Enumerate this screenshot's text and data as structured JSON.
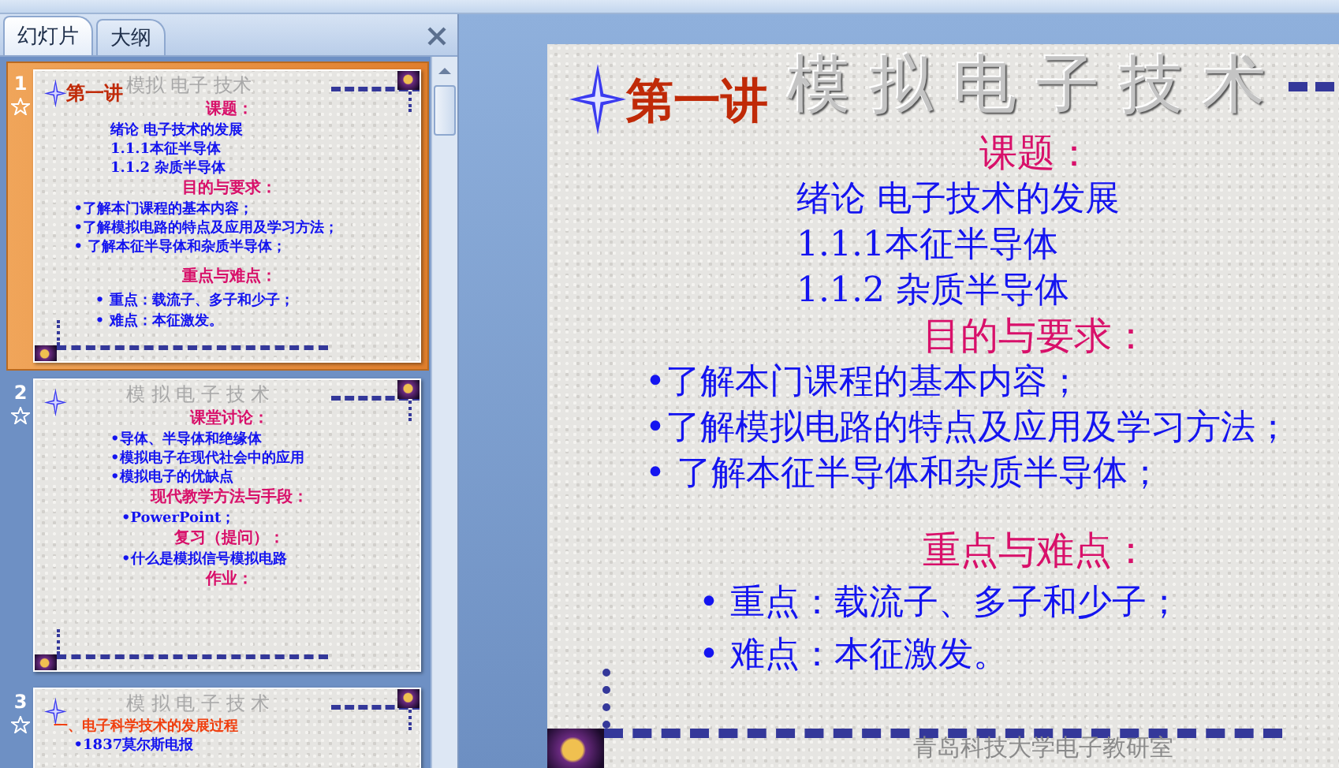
{
  "panel": {
    "tabs": [
      {
        "label": "幻灯片",
        "selected": true
      },
      {
        "label": "大纲",
        "selected": false
      }
    ]
  },
  "thumbnails": [
    {
      "number": "1",
      "selected": true,
      "title": "模拟 电子 技术",
      "label": "第一讲",
      "blocks": [
        {
          "lines": [
            {
              "kind": "heading",
              "text": "课题："
            },
            {
              "kind": "topic",
              "text": "绪论  电子技术的发展"
            },
            {
              "kind": "topic",
              "text": "1.1.1本征半导体"
            },
            {
              "kind": "topic",
              "text": "1.1.2      杂质半导体"
            },
            {
              "kind": "heading",
              "text": "目的与要求："
            },
            {
              "kind": "bullet",
              "text": "•了解本门课程的基本内容；"
            },
            {
              "kind": "bullet",
              "text": "•了解模拟电路的特点及应用及学习方法；"
            },
            {
              "kind": "bullet",
              "text": "•  了解本征半导体和杂质半导体；"
            }
          ]
        },
        {
          "lines": [
            {
              "kind": "heading",
              "text": "重点与难点："
            },
            {
              "kind": "point",
              "text": "•  重点：载流子、多子和少子；"
            },
            {
              "kind": "point",
              "text": "•  难点：本征激发。"
            }
          ]
        }
      ]
    },
    {
      "number": "2",
      "selected": false,
      "title": "模 拟 电 子 技 术",
      "blocks": [
        {
          "lines": [
            {
              "kind": "heading",
              "text": "课堂讨论："
            },
            {
              "kind": "topic",
              "text": "•导体、半导体和绝缘体"
            },
            {
              "kind": "topic",
              "text": "•模拟电子在现代社会中的应用"
            },
            {
              "kind": "topic",
              "text": "•模拟电子的优缺点"
            },
            {
              "kind": "heading",
              "text": "现代教学方法与手段："
            },
            {
              "kind": "heading-note",
              "text": "•PowerPoint；"
            },
            {
              "kind": "heading",
              "text": "复习（提问）："
            },
            {
              "kind": "heading-note",
              "text": "•什么是模拟信号模拟电路"
            },
            {
              "kind": "heading",
              "text": "作业："
            }
          ]
        }
      ]
    },
    {
      "number": "3",
      "selected": false,
      "title": "模 拟 电 子 技 术",
      "blocks": [
        {
          "lines": [
            {
              "kind": "section",
              "text": "一、电子科学技术的发展过程"
            },
            {
              "kind": "bullet",
              "text": "•1837莫尔斯电报"
            }
          ]
        }
      ]
    }
  ],
  "main_slide": {
    "title": "模 拟 电 子 技 术",
    "label": "第一讲",
    "footer": "青岛科技大学电子教研室",
    "blocks": [
      {
        "lines": [
          {
            "kind": "heading",
            "text": "课题："
          },
          {
            "kind": "topic",
            "text": "绪论  电子技术的发展"
          },
          {
            "kind": "topic",
            "text": "1.1.1本征半导体"
          },
          {
            "kind": "topic",
            "text": "1.1.2      杂质半导体"
          },
          {
            "kind": "heading",
            "text": "目的与要求："
          },
          {
            "kind": "bullet",
            "text": "•了解本门课程的基本内容；"
          },
          {
            "kind": "bullet",
            "text": "•了解模拟电路的特点及应用及学习方法；"
          },
          {
            "kind": "bullet",
            "text": "•  了解本征半导体和杂质半导体；"
          }
        ]
      },
      {
        "lines": [
          {
            "kind": "heading",
            "text": "重点与难点："
          },
          {
            "kind": "point",
            "text": "•  重点：载流子、多子和少子；"
          },
          {
            "kind": "point",
            "text": "•  难点：本征激发。"
          }
        ]
      }
    ]
  }
}
